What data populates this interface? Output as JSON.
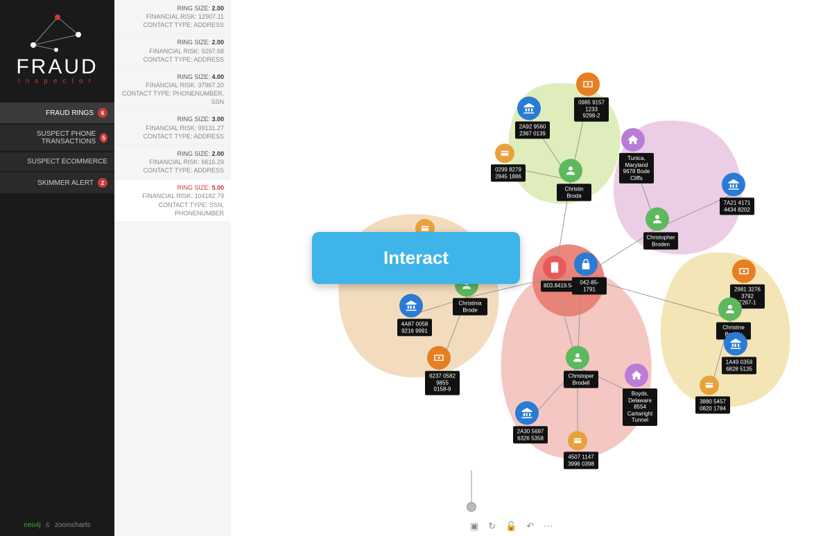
{
  "app": {
    "title": "FRAUD",
    "subtitle": "Inspector"
  },
  "nav": [
    {
      "label": "FRAUD RINGS",
      "badge": "6",
      "active": true
    },
    {
      "label": "SUSPECT PHONE TRANSACTIONS",
      "badge": "5",
      "active": false
    },
    {
      "label": "SUSPECT ECOMMERCE",
      "badge": "",
      "active": false
    },
    {
      "label": "SKIMMER ALERT",
      "badge": "2",
      "active": false
    }
  ],
  "rings": [
    {
      "size": "2.00",
      "risk": "12907.11",
      "contact": "ADDRESS",
      "selected": false
    },
    {
      "size": "2.00",
      "risk": "9297.68",
      "contact": "ADDRESS",
      "selected": false
    },
    {
      "size": "4.00",
      "risk": "37967.20",
      "contact": "PHONENUMBER, SSN",
      "selected": false
    },
    {
      "size": "3.00",
      "risk": "99131.27",
      "contact": "ADDRESS",
      "selected": false
    },
    {
      "size": "2.00",
      "risk": "6616.29",
      "contact": "ADDRESS",
      "selected": false
    },
    {
      "size": "5.00",
      "risk": "104182.79",
      "contact": "SSN, PHONENUMBER",
      "selected": true
    }
  ],
  "labels": {
    "ring_size": "RING SIZE:",
    "financial_risk": "FINANCIAL RISK:",
    "contact_type": "CONTACT TYPE:"
  },
  "interact_label": "Interact",
  "footer": {
    "neo": "neo4j",
    "amp": "&",
    "zoom": "zoomcharts"
  },
  "nodes": {
    "n1": {
      "label": "2A92 9560\n2367 0139",
      "type": "bank"
    },
    "n2": {
      "label": "0985 9157 1233\n9298-2",
      "type": "loan"
    },
    "n3": {
      "label": "0299 8279\n2845 1886",
      "type": "card"
    },
    "n4": {
      "label": "Christin\nBroda",
      "type": "person"
    },
    "n5": {
      "label": "Tunica, Maryland\n9678 Bode Cliffs",
      "type": "address"
    },
    "n6": {
      "label": "7A21 4171\n4434 8202",
      "type": "bank"
    },
    "n7": {
      "label": "Christopher\nBroden",
      "type": "person"
    },
    "n8": {
      "label": "803.8419.5462.1",
      "type": "phone"
    },
    "n9": {
      "label": "042-85-1791",
      "type": "ssn"
    },
    "n10": {
      "label": "Christinia\nBrode",
      "type": "person"
    },
    "n11": {
      "label": "4A87 0058\n9216 9991",
      "type": "bank"
    },
    "n12": {
      "label": "6237 0582 9855\n0158-9",
      "type": "loan"
    },
    "n13": {
      "label": "2981 3276 3792\n7267-1",
      "type": "loan"
    },
    "n14": {
      "label": "Christine\nBroddy",
      "type": "person"
    },
    "n15": {
      "label": "1A49 0359\n6828 5135",
      "type": "bank"
    },
    "n16": {
      "label": "3880 5457\n0820 1784",
      "type": "card"
    },
    "n17": {
      "label": "Christoper\nBrodell",
      "type": "person"
    },
    "n18": {
      "label": "Boyds, Delaware\n8554 Cartwright\nTunnel",
      "type": "address"
    },
    "n19": {
      "label": "2A30 5697\n6326 5358",
      "type": "bank"
    },
    "n20": {
      "label": "4507 1147\n3996 0398",
      "type": "card"
    },
    "n21": {
      "label": "",
      "type": "card"
    }
  }
}
